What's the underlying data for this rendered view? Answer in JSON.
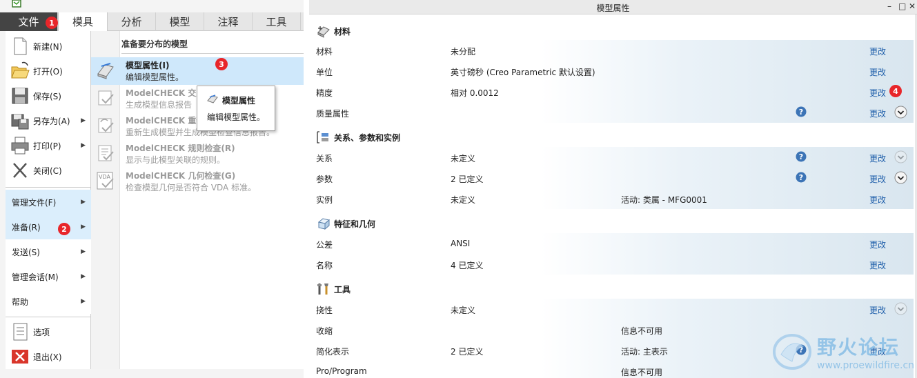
{
  "ribbon": {
    "tabs": [
      "文件",
      "模具",
      "分析",
      "模型",
      "注释",
      "工具"
    ]
  },
  "file_menu": {
    "items": [
      {
        "label": "新建(N)",
        "icon": "new-document-icon"
      },
      {
        "label": "打开(O)",
        "icon": "open-folder-icon"
      },
      {
        "label": "保存(S)",
        "icon": "save-disk-icon"
      },
      {
        "label": "另存为(A)",
        "icon": "save-as-icon",
        "has_submenu": true
      },
      {
        "label": "打印(P)",
        "icon": "print-icon",
        "has_submenu": true
      },
      {
        "label": "关闭(C)",
        "icon": "close-x-icon"
      }
    ],
    "submenus": [
      "管理文件(F)",
      "准备(R)",
      "发送(S)",
      "管理会话(M)",
      "帮助"
    ],
    "bottom": [
      {
        "label": "选项",
        "icon": "options-list-icon"
      },
      {
        "label": "退出(X)",
        "icon": "exit-icon"
      }
    ]
  },
  "prepare_panel": {
    "header": "准备要分布的模型",
    "items": [
      {
        "title": "模型属性(I)",
        "desc": "编辑模型属性。",
        "selected": true
      },
      {
        "title": "ModelCHECK 交互",
        "desc": "生成模型信息报告",
        "disabled": true
      },
      {
        "title": "ModelCHECK 重新",
        "desc": "重新生成模型并生成模型检查信息报告。",
        "disabled": true
      },
      {
        "title": "ModelCHECK 规则检查(R)",
        "desc": "显示与此模型关联的规则。",
        "disabled": true
      },
      {
        "title": "ModelCHECK 几何检查(G)",
        "desc": "检查模型几何是否符合 VDA 标准。",
        "disabled": true,
        "icon_text": "VDA"
      }
    ],
    "tooltip": {
      "title": "模型属性",
      "desc": "编辑模型属性。"
    }
  },
  "badges": [
    "1",
    "2",
    "3",
    "4"
  ],
  "dialog": {
    "title": "模型属性",
    "window_buttons": [
      "–",
      "□",
      "✕"
    ],
    "sections": [
      {
        "name": "材料",
        "icon": "material-icon",
        "rows": [
          {
            "label": "材料",
            "value": "未分配",
            "link": "更改"
          },
          {
            "label": "单位",
            "value": "英寸磅秒 (Creo Parametric 默认设置)",
            "link": "更改"
          },
          {
            "label": "精度",
            "value": "相对 0.0012",
            "link": "更改"
          },
          {
            "label": "质量属性",
            "value": "",
            "link": "更改",
            "help": true,
            "expand": "dark"
          }
        ]
      },
      {
        "name": "关系、参数和实例",
        "icon": "relations-icon",
        "rows": [
          {
            "label": "关系",
            "value": "未定义",
            "link": "更改",
            "help": true,
            "expand": "faded"
          },
          {
            "label": "参数",
            "value": "2 已定义",
            "link": "更改",
            "help": true,
            "expand": "dark"
          },
          {
            "label": "实例",
            "value": "未定义",
            "extra": "活动: 类属 - MFG0001",
            "link": "更改"
          }
        ]
      },
      {
        "name": "特征和几何",
        "icon": "features-icon",
        "rows": [
          {
            "label": "公差",
            "value": "ANSI",
            "link": "更改"
          },
          {
            "label": "名称",
            "value": "4 已定义",
            "link": "更改"
          }
        ]
      },
      {
        "name": "工具",
        "icon": "tools-icon",
        "rows": [
          {
            "label": "挠性",
            "value": "未定义",
            "link": "更改",
            "expand": "faded"
          },
          {
            "label": "收缩",
            "value": "",
            "extra": "信息不可用"
          },
          {
            "label": "简化表示",
            "value": "2 已定义",
            "extra": "活动: 主表示",
            "link": "更改",
            "help": true
          },
          {
            "label": "Pro/Program",
            "value": "",
            "extra": "信息不可用"
          }
        ]
      }
    ]
  },
  "watermark": {
    "cn": "野火论坛",
    "url": "www.proewildfire.cn"
  },
  "colors": {
    "accent": "#1f5faa",
    "badge": "#e8262a",
    "selection": "#cfe8fb"
  }
}
